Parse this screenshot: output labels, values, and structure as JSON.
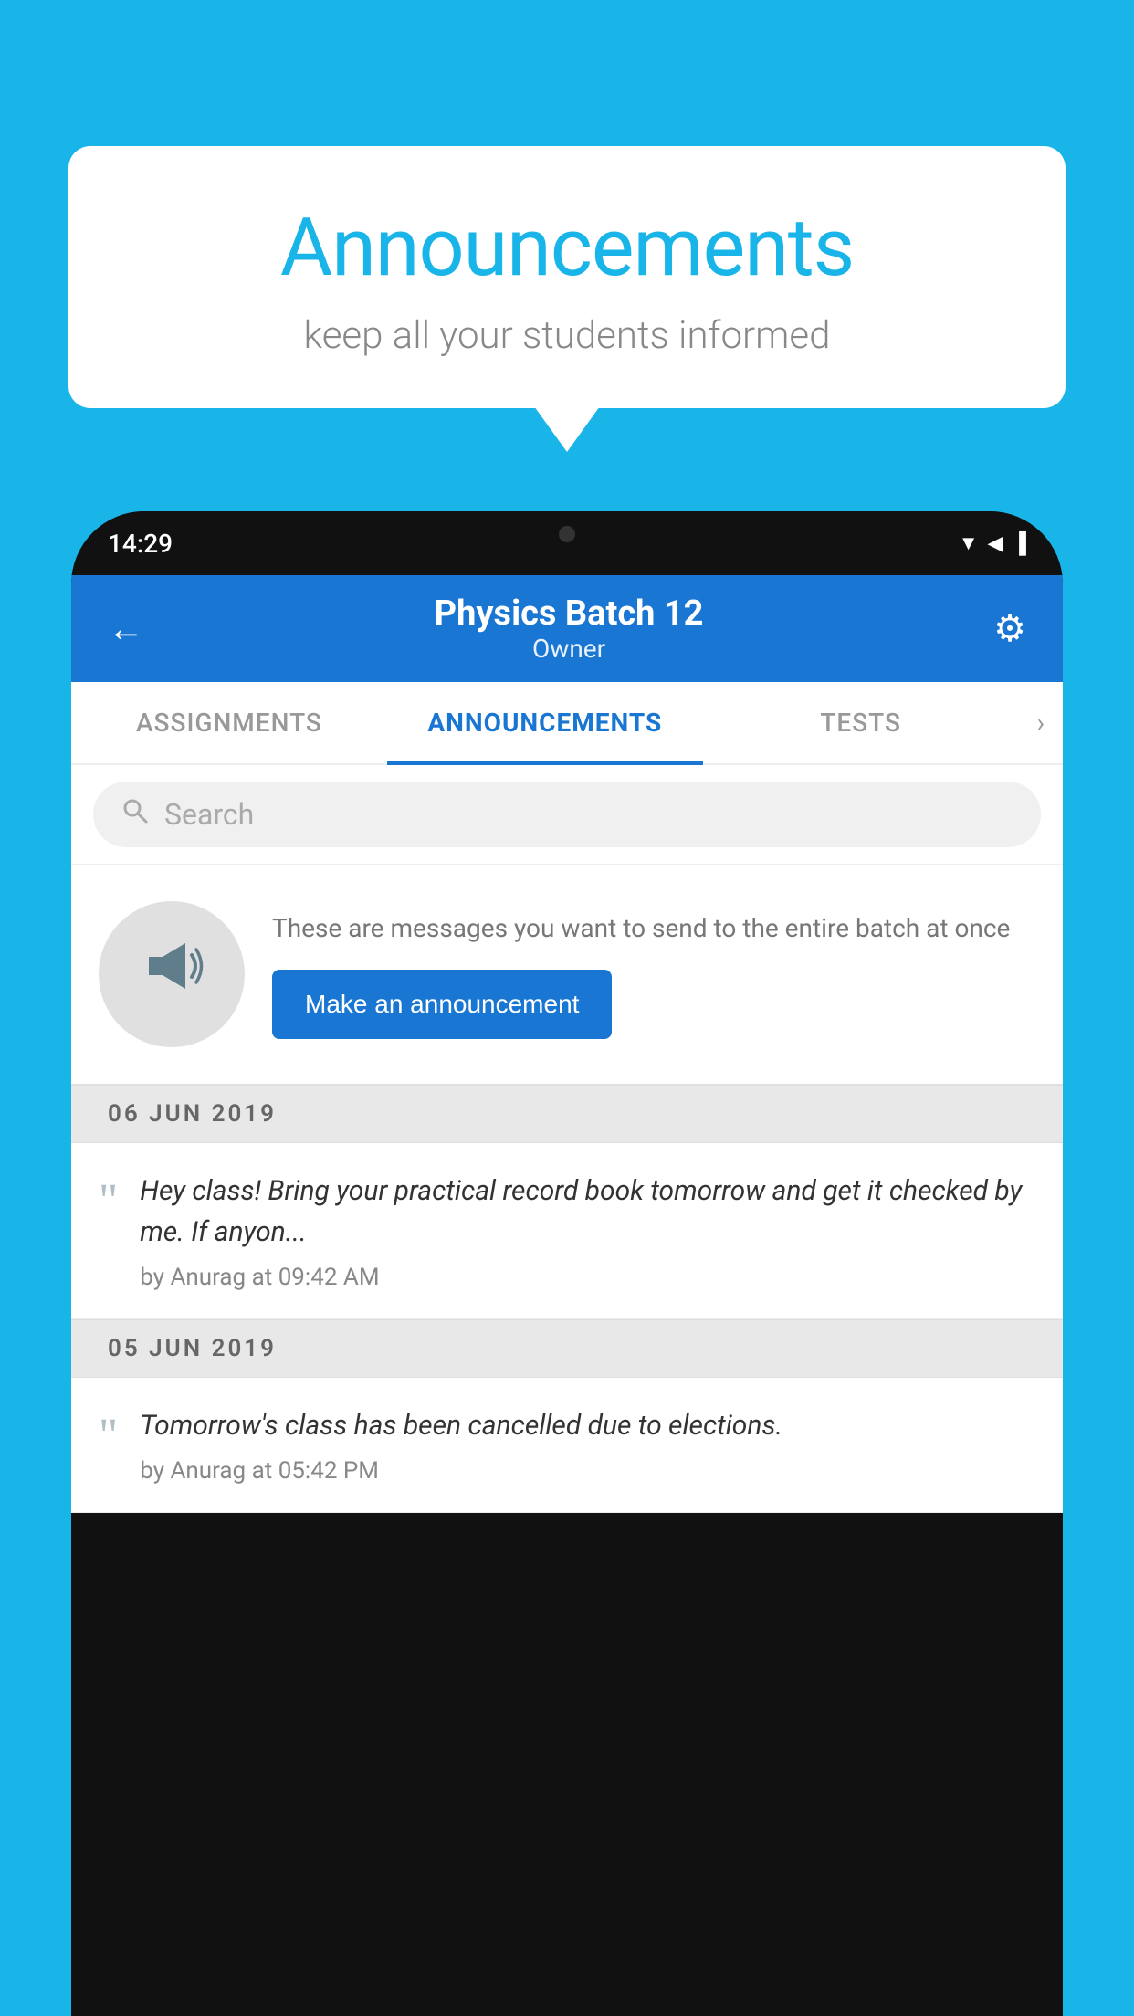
{
  "background_color": "#1ab5e8",
  "bubble": {
    "title": "Announcements",
    "subtitle": "keep all your students informed"
  },
  "phone": {
    "status_bar": {
      "time": "14:29",
      "icons": [
        "▼",
        "◀",
        "▐"
      ]
    },
    "header": {
      "back_label": "←",
      "title": "Physics Batch 12",
      "subtitle": "Owner",
      "gear_label": "⚙"
    },
    "tabs": [
      {
        "label": "ASSIGNMENTS",
        "active": false
      },
      {
        "label": "ANNOUNCEMENTS",
        "active": true
      },
      {
        "label": "TESTS",
        "active": false
      }
    ],
    "search": {
      "placeholder": "Search"
    },
    "promo": {
      "description": "These are messages you want to send to the entire batch at once",
      "button_label": "Make an announcement"
    },
    "announcements": [
      {
        "date": "06  JUN  2019",
        "body": "Hey class! Bring your practical record book tomorrow and get it checked by me. If anyon...",
        "meta": "by Anurag at 09:42 AM"
      },
      {
        "date": "05  JUN  2019",
        "body": "Tomorrow's class has been cancelled due to elections.",
        "meta": "by Anurag at 05:42 PM"
      }
    ]
  }
}
